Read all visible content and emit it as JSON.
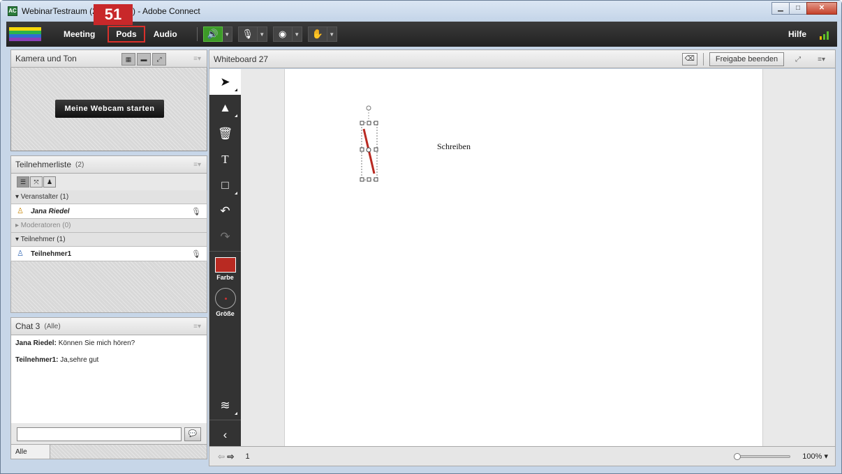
{
  "window": {
    "title": "WebinarTestraum (2. Webinar) - Adobe Connect",
    "minimize": "▁",
    "maximize": "□",
    "close": "✕"
  },
  "menubar": {
    "items": [
      {
        "label": "Meeting"
      },
      {
        "label": "Pods"
      },
      {
        "label": "Audio"
      }
    ],
    "help": "Hilfe",
    "step_badge": "51",
    "highlight_color": "#d9302b"
  },
  "camera_pod": {
    "title": "Kamera und Ton",
    "start_button": "Meine Webcam starten"
  },
  "attendees_pod": {
    "title": "Teilnehmerliste",
    "count": "(2)",
    "groups": [
      {
        "label": "▾ Veranstalter (1)",
        "members": [
          {
            "name": "Jana Riedel",
            "icon": "host-icon",
            "status_icon": "mic-muted-icon"
          }
        ]
      },
      {
        "label": "▸ Moderatoren (0)",
        "members": []
      },
      {
        "label": "▾ Teilnehmer (1)",
        "members": [
          {
            "name": "Teilnehmer1",
            "icon": "participant-icon",
            "status_icon": "microphone-icon"
          }
        ]
      }
    ]
  },
  "chat_pod": {
    "title": "Chat 3",
    "scope": "(Alle)",
    "messages": [
      {
        "author": "Jana Riedel:",
        "text": " Können Sie mich hören?"
      },
      {
        "author": "Teilnehmer1:",
        "text": " Ja,sehre gut"
      }
    ],
    "recipient": "Alle"
  },
  "whiteboard": {
    "title": "Whiteboard 27",
    "stop_sharing": "Freigabe beenden",
    "canvas_text": "Schreiben",
    "color_label": "Farbe",
    "size_label": "Größe",
    "current_color": "#b92a22",
    "page": "1",
    "zoom": "100%"
  }
}
